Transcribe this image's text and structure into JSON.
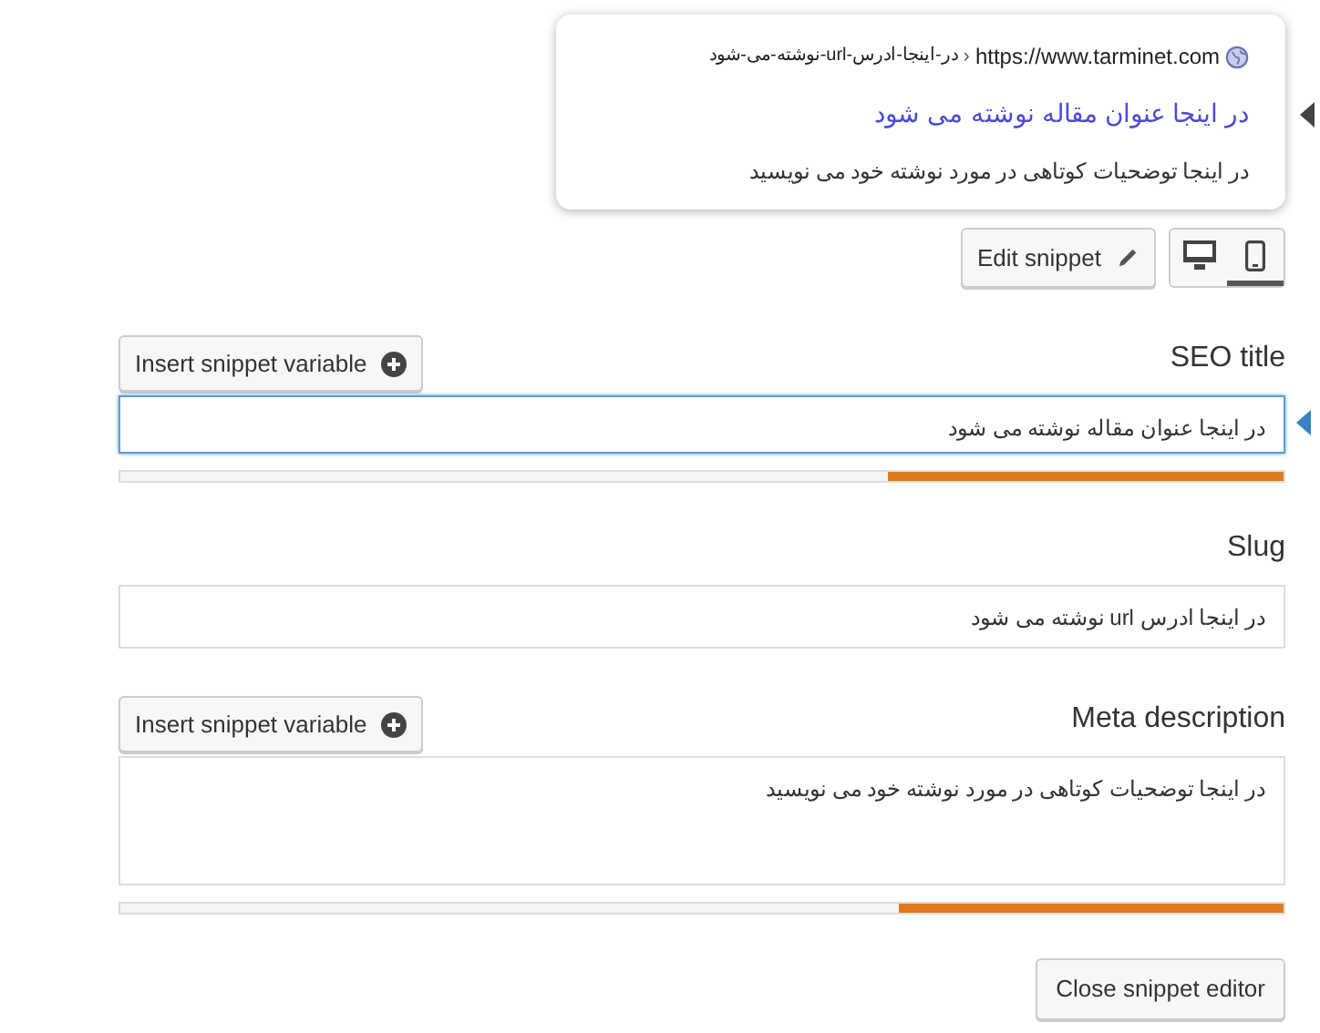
{
  "preview": {
    "url": "https://www.tarminet.com",
    "separator": "›",
    "path": "در-اینجا-ادرس-url-نوشته-می-شود",
    "title": "در اینجا عنوان مقاله نوشته می شود",
    "description": "در اینجا توضحیات کوتاهی در مورد نوشته خود می نویسید"
  },
  "edit_button": "Edit snippet",
  "modes": [
    {
      "kind": "desktop",
      "selected": false
    },
    {
      "kind": "mobile",
      "selected": true
    }
  ],
  "seo_title": {
    "label": "SEO title",
    "button": "Insert snippet variable",
    "value": "در اینجا عنوان مقاله نوشته می شود",
    "focused": true,
    "level": 0.34
  },
  "slug": {
    "label": "Slug",
    "value": "در اینجا ادرس url نوشته می شود",
    "focused": false
  },
  "meta_description": {
    "label": "Meta description",
    "button": "Insert snippet variable",
    "value": "در اینجا توضحیات کوتاهی در مورد نوشته خود می نویسید",
    "focused": false,
    "level": 0.33
  },
  "close_button": "Close snippet editor"
}
